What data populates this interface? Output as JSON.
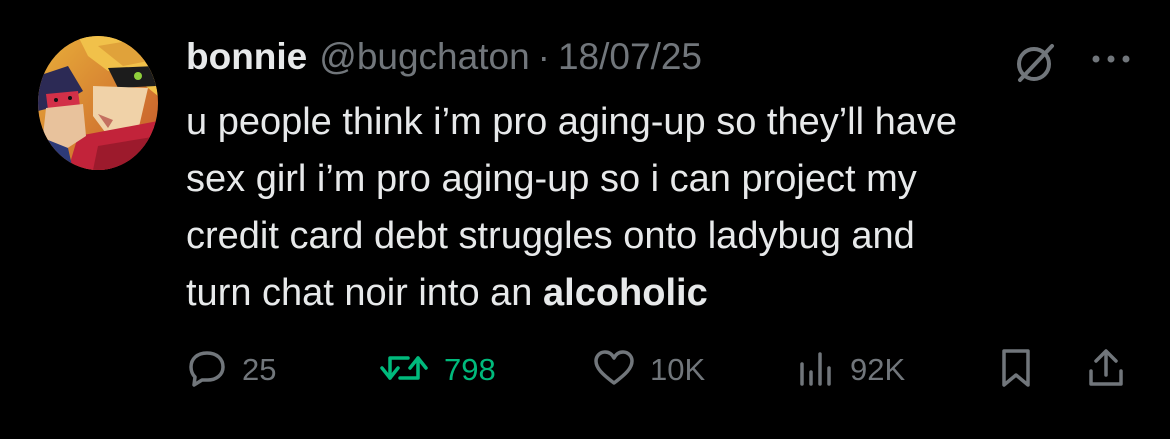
{
  "post": {
    "author": {
      "display_name": "bonnie",
      "handle": "@bugchaton"
    },
    "separator": "·",
    "date": "18/07/25",
    "text": {
      "line1": "u people think i’m pro aging-up so they’ll have",
      "line2": "sex girl i’m pro aging-up so i can project my",
      "line3": "credit card debt struggles onto ladybug and",
      "line4_prefix": "turn chat noir into an ",
      "line4_bold": "alcoholic"
    },
    "header_icons": [
      "grok-icon",
      "more-icon"
    ],
    "actions": {
      "reply": {
        "icon": "reply-icon",
        "count": "25"
      },
      "repost": {
        "icon": "repost-icon",
        "count": "798",
        "color": "#00ba7c"
      },
      "like": {
        "icon": "heart-icon",
        "count": "10K"
      },
      "views": {
        "icon": "views-icon",
        "count": "92K"
      },
      "bookmark": {
        "icon": "bookmark-icon"
      },
      "share": {
        "icon": "share-icon"
      }
    }
  },
  "colors": {
    "background": "#000000",
    "text_primary": "#e7e9ea",
    "text_secondary": "#71767b",
    "repost_green": "#00ba7c"
  }
}
